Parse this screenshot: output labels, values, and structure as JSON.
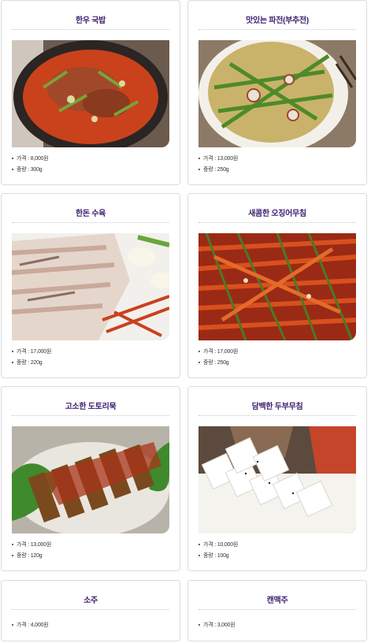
{
  "menu": [
    {
      "title": "한우 국밥",
      "price": "가격 : 8,000원",
      "weight": "중량 : 300g",
      "image": "beef-gukbap"
    },
    {
      "title": "맛있는 파전(부추전)",
      "price": "가격 : 13,000원",
      "weight": "중량 : 250g",
      "image": "pajeon"
    },
    {
      "title": "한돈 수육",
      "price": "가격 : 17,000원",
      "weight": "중량 : 220g",
      "image": "suyuk"
    },
    {
      "title": "새콤한 오징어무침",
      "price": "가격 : 17,000원",
      "weight": "중량 : 250g",
      "image": "squid-muchim"
    },
    {
      "title": "고소한 도토리묵",
      "price": "가격 : 13,000원",
      "weight": "중량 : 120g",
      "image": "dotorimuk"
    },
    {
      "title": "담백한 두부무침",
      "price": "가격 : 10,000원",
      "weight": "중량 : 100g",
      "image": "tofu-muchim"
    },
    {
      "title": "소주",
      "price": "가격 : 4,000원"
    },
    {
      "title": "캔맥주",
      "price": "가격 : 3,000원"
    }
  ]
}
